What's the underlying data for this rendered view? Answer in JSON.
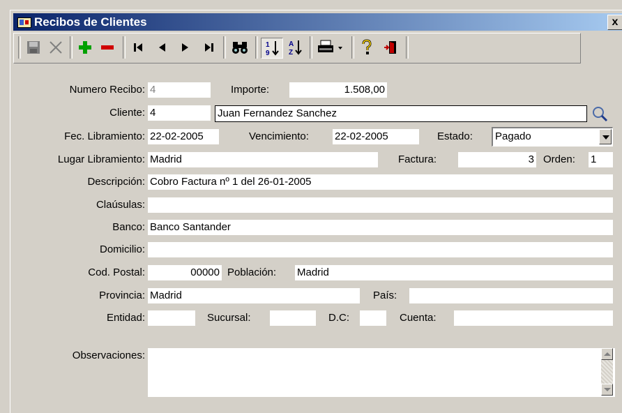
{
  "window": {
    "title": "Recibos de Clientes",
    "close_label": "x"
  },
  "toolbar": {
    "buttons": [
      {
        "name": "save-button",
        "icon": "floppy-icon"
      },
      {
        "name": "cancel-button",
        "icon": "x-icon"
      },
      {
        "name": "add-record-button",
        "icon": "plus-icon"
      },
      {
        "name": "delete-record-button",
        "icon": "minus-icon"
      },
      {
        "name": "first-record-button",
        "icon": "first-icon"
      },
      {
        "name": "prev-record-button",
        "icon": "prev-icon"
      },
      {
        "name": "next-record-button",
        "icon": "next-icon"
      },
      {
        "name": "last-record-button",
        "icon": "last-icon"
      },
      {
        "name": "search-button",
        "icon": "binoculars-icon"
      },
      {
        "name": "sort-numeric-button",
        "icon": "sort-numeric-icon"
      },
      {
        "name": "sort-alpha-button",
        "icon": "sort-alpha-icon"
      },
      {
        "name": "print-button",
        "icon": "printer-icon"
      },
      {
        "name": "help-button",
        "icon": "question-icon"
      },
      {
        "name": "exit-button",
        "icon": "exit-door-icon"
      }
    ]
  },
  "form": {
    "numero_recibo": {
      "label": "Numero Recibo:",
      "value": "4"
    },
    "importe": {
      "label": "Importe:",
      "value": "1.508,00"
    },
    "cliente": {
      "label": "Cliente:",
      "code": "4",
      "name": "Juan Fernandez Sanchez"
    },
    "fec_libramiento": {
      "label": "Fec. Libramiento:",
      "value": "22-02-2005"
    },
    "vencimiento": {
      "label": "Vencimiento:",
      "value": "22-02-2005"
    },
    "estado": {
      "label": "Estado:",
      "value": "Pagado"
    },
    "lugar_libramiento": {
      "label": "Lugar Libramiento:",
      "value": "Madrid"
    },
    "factura": {
      "label": "Factura:",
      "value": "3"
    },
    "orden": {
      "label": "Orden:",
      "value": "1"
    },
    "descripcion": {
      "label": "Descripción:",
      "value": "Cobro Factura nº 1 del 26-01-2005"
    },
    "clausulas": {
      "label": "Claúsulas:",
      "value": ""
    },
    "banco": {
      "label": "Banco:",
      "value": "Banco Santander"
    },
    "domicilio": {
      "label": "Domicilio:",
      "value": ""
    },
    "cod_postal": {
      "label": "Cod. Postal:",
      "value": "00000"
    },
    "poblacion": {
      "label": "Población:",
      "value": "Madrid"
    },
    "provincia": {
      "label": "Provincia:",
      "value": "Madrid"
    },
    "pais": {
      "label": "País:",
      "value": ""
    },
    "entidad": {
      "label": "Entidad:",
      "value": ""
    },
    "sucursal": {
      "label": "Sucursal:",
      "value": ""
    },
    "dc": {
      "label": "D.C:",
      "value": ""
    },
    "cuenta": {
      "label": "Cuenta:",
      "value": ""
    },
    "observaciones": {
      "label": "Observaciones:",
      "value": ""
    }
  },
  "colors": {
    "title_start": "#0a246a",
    "title_end": "#a6caf0",
    "face": "#d4d0c8",
    "add_green": "#00a000",
    "delete_red": "#d00000"
  }
}
